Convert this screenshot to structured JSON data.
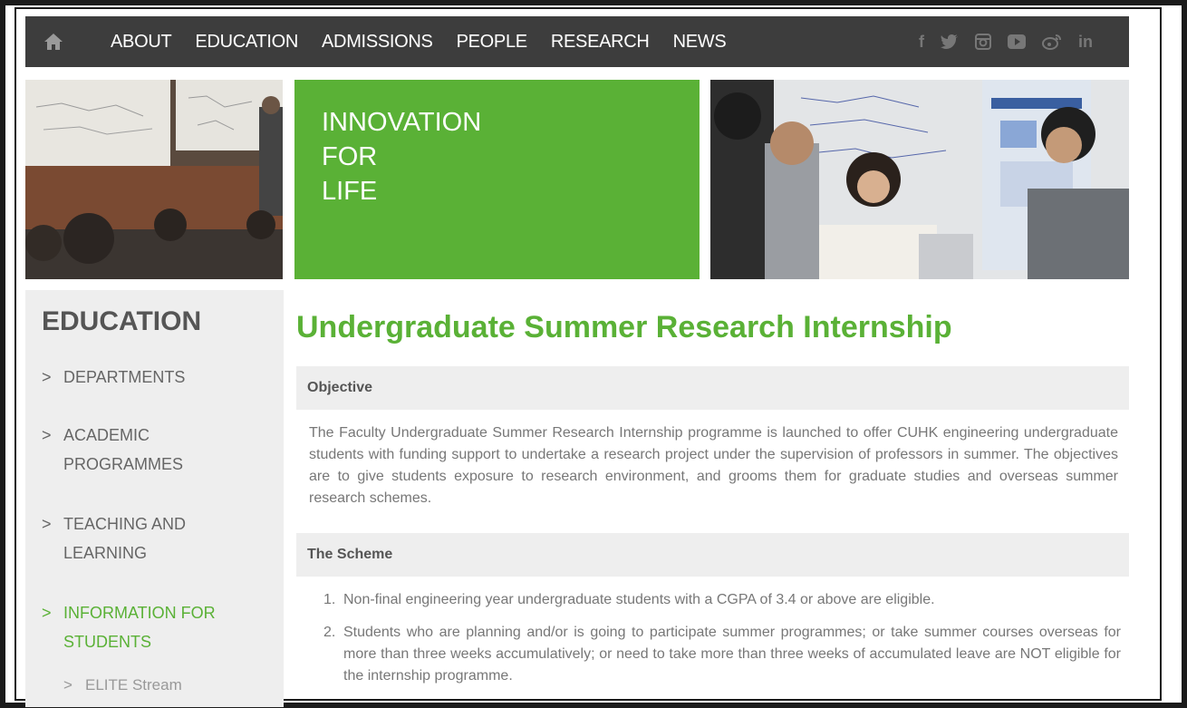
{
  "nav": {
    "items": [
      "ABOUT",
      "EDUCATION",
      "ADMISSIONS",
      "PEOPLE",
      "RESEARCH",
      "NEWS"
    ],
    "social": [
      "f",
      "in"
    ]
  },
  "banner": {
    "tagline": [
      "INNOVATION",
      "FOR",
      "LIFE"
    ]
  },
  "sidebar": {
    "heading": "EDUCATION",
    "arrow": ">",
    "items": [
      {
        "label": "DEPARTMENTS"
      },
      {
        "label": "ACADEMIC PROGRAMMES"
      },
      {
        "label": "TEACHING AND LEARNING"
      },
      {
        "label": "INFORMATION FOR STUDENTS"
      },
      {
        "label": "ELITE Stream"
      }
    ]
  },
  "main": {
    "title": "Undergraduate Summer Research Internship",
    "sections": [
      {
        "heading": "Objective",
        "text": "The Faculty Undergraduate Summer Research Internship programme is launched to offer CUHK engineering undergraduate students with funding support to undertake a research project under the supervision of professors in summer.  The objectives are to give students exposure to research environment, and grooms them for graduate studies and overseas summer research schemes."
      },
      {
        "heading": "The Scheme",
        "items": [
          {
            "num": "1.",
            "text": "Non-final engineering year undergraduate students with a CGPA of 3.4 or above are eligible."
          },
          {
            "num": "2.",
            "text": "Students who are planning and/or is going to participate summer programmes; or take summer courses overseas for more than three weeks accumulatively; or need to take more than three weeks of accumulated leave are NOT eligible for the internship programme."
          }
        ]
      }
    ]
  },
  "colors": {
    "accent": "#5ab136",
    "nav_bg": "#3d3d3d",
    "sidebar_bg": "#eeeeee"
  }
}
